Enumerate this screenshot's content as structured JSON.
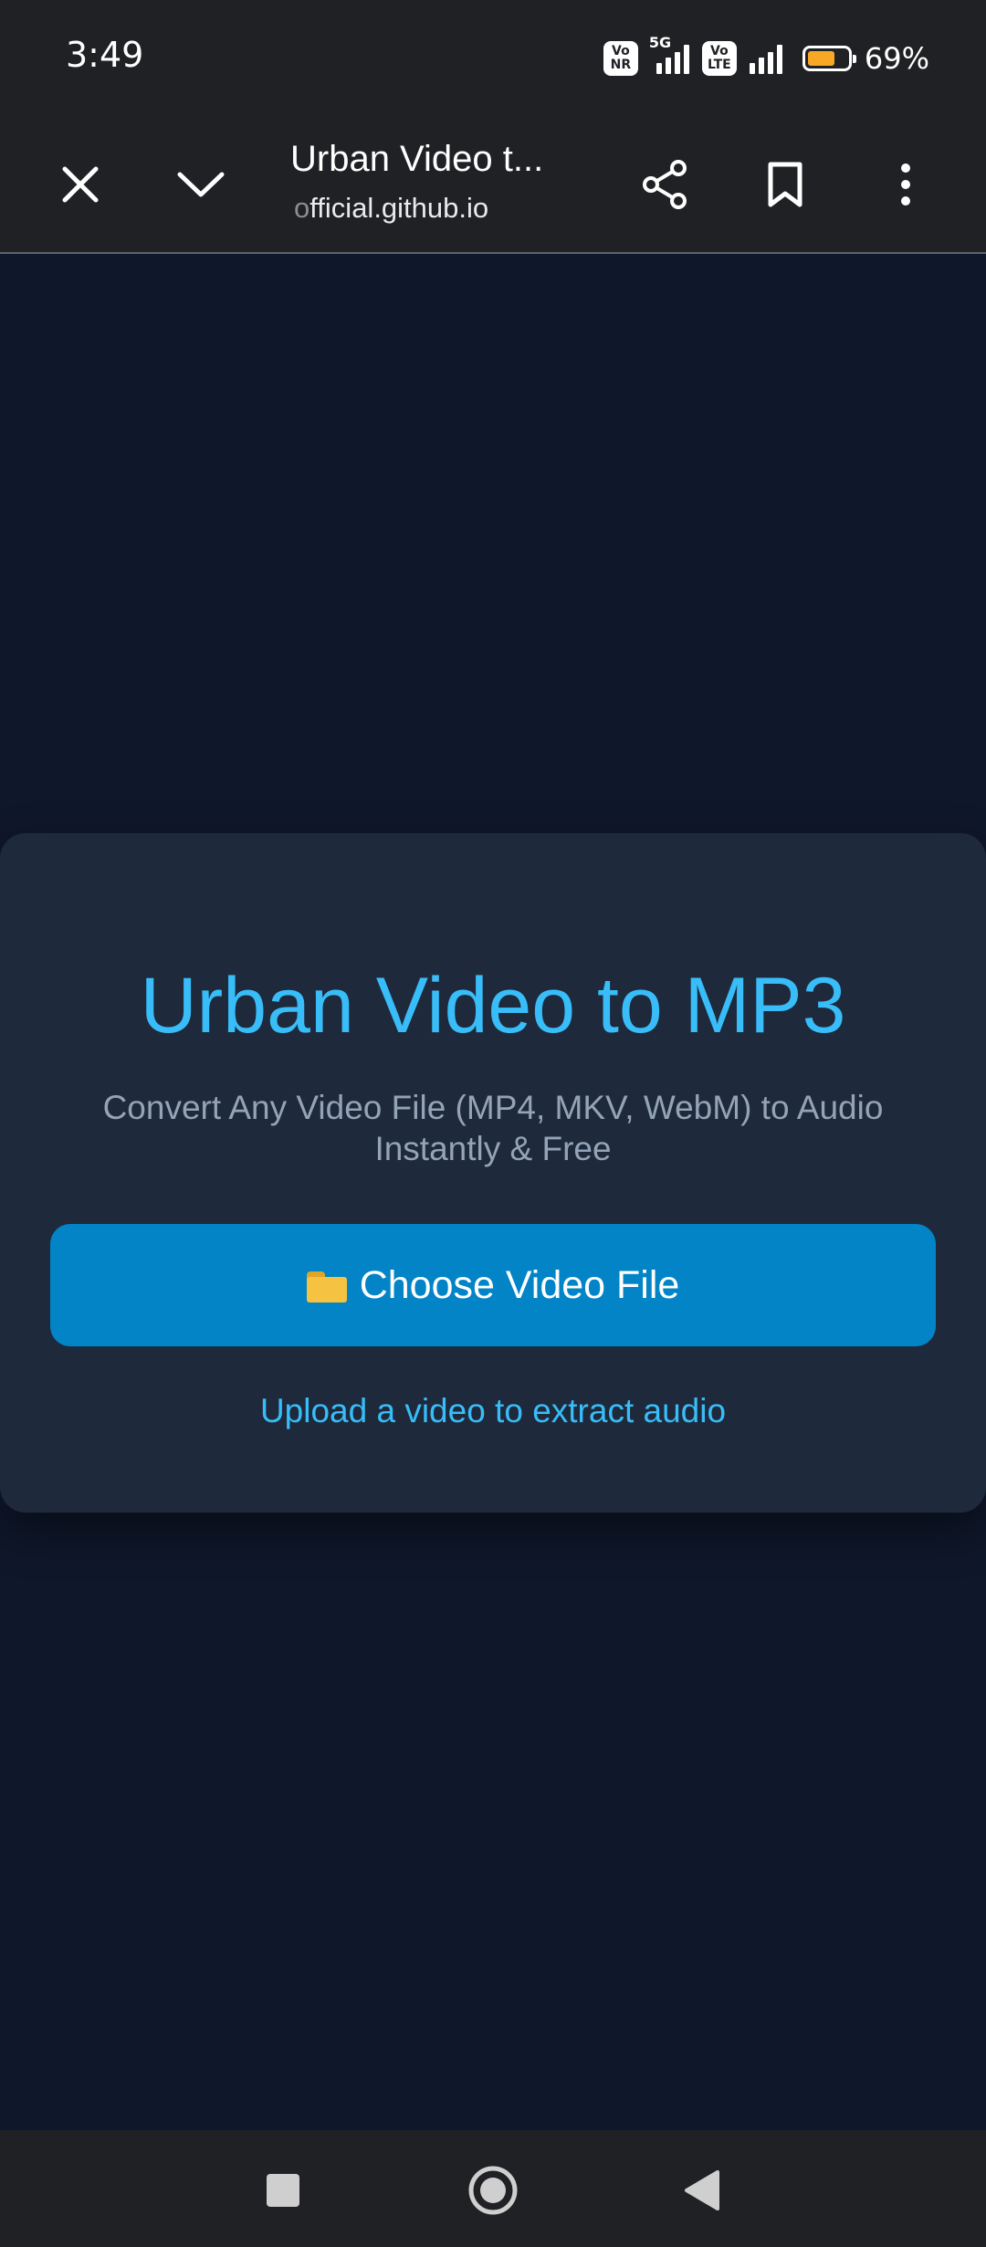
{
  "status_bar": {
    "time": "3:49",
    "net_badge_1_top": "Vo",
    "net_badge_1_bottom": "NR",
    "net_5g": "5G",
    "net_badge_2_top": "Vo",
    "net_badge_2_bottom": "LTE",
    "battery_level": 0.69,
    "battery_text": "69%",
    "battery_color": "#f9a825"
  },
  "browser": {
    "tab_title": "Urban Video t...",
    "url_faded": "o",
    "url_rest": "fficial.github.io",
    "icons": [
      "close-icon",
      "chevron-down-icon",
      "share-icon",
      "bookmark-icon",
      "more-vert-icon"
    ]
  },
  "page": {
    "title": "Urban Video to MP3",
    "subtitle": "Convert Any Video File (MP4, MKV, WebM) to Audio Instantly & Free",
    "choose_button_label": "Choose Video File",
    "choose_button_icon": "folder-icon",
    "status": "Upload a video to extract audio",
    "accent_color": "#38bdf8",
    "button_color": "#0284c7",
    "background_color": "#0f172a",
    "card_color": "#1e293b"
  },
  "nav": {
    "icons": [
      "recents-square-icon",
      "home-circle-icon",
      "back-triangle-icon"
    ]
  }
}
